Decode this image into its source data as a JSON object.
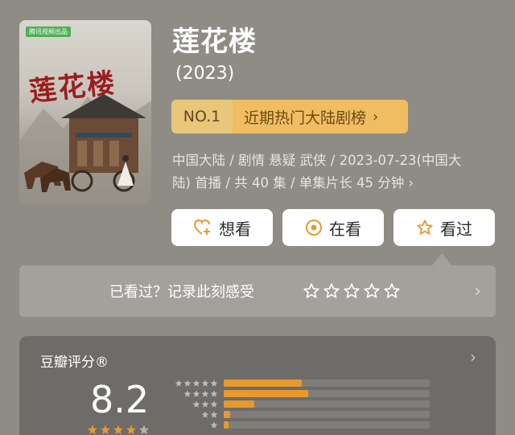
{
  "poster": {
    "badge": "腾讯视频出品",
    "title_art": "莲花楼"
  },
  "title": "莲花楼",
  "year": "(2023)",
  "rank": {
    "no": "NO.1",
    "label": "近期热门大陆剧榜",
    "chev": "›"
  },
  "meta_line1": "中国大陆 / 剧情 悬疑 武侠 / 2023-07-23(中国大",
  "meta_line2": "陆) 首播 / 共 40 集 / 单集片长 45 分钟 ›",
  "buttons": {
    "want": "想看",
    "watching": "在看",
    "watched": "看过"
  },
  "record": {
    "label": "已看过？记录此刻感受",
    "chev": "›"
  },
  "rating": {
    "header": "豆瓣评分®",
    "chev": "›",
    "score": "8.2",
    "distribution": [
      0.38,
      0.41,
      0.15,
      0.03,
      0.02
    ]
  },
  "colors": {
    "bar": "#e69a2e",
    "rank_bg": "#f0bd62"
  }
}
